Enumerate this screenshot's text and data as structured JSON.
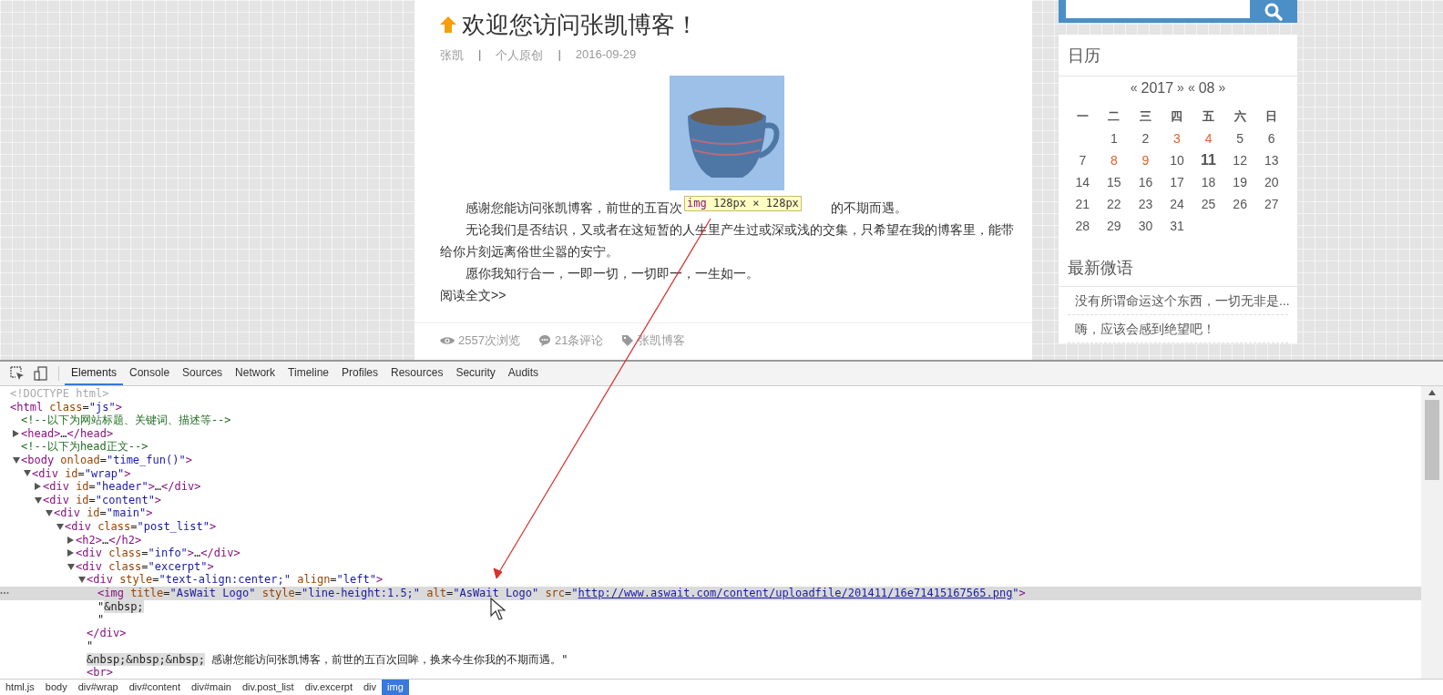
{
  "post": {
    "title": "欢迎您访问张凯博客！",
    "meta": [
      {
        "kind": "text",
        "text": "张凯"
      },
      {
        "kind": "separator",
        "text": "|"
      },
      {
        "kind": "text",
        "text": "个人原创"
      },
      {
        "kind": "separator",
        "text": "|"
      },
      {
        "kind": "text",
        "text": "2016-09-29"
      }
    ],
    "paragraphs": [
      {
        "text_left": "感谢您能访问张凯博客，前世的五百次",
        "tooltip": {
          "tag": "img",
          "size": "128px × 128px"
        },
        "text_right": "的不期而遇。"
      },
      {
        "text": "无论我们是否结识，又或者在这短暂的人生里产生过或深或浅的交集，只希望在我的博客里，能带给你片刻远离俗世尘嚣的安宁。"
      },
      {
        "text": "愿你我知行合一，一即一切，一切即一，一生如一。"
      }
    ],
    "read_more": "阅读全文>>",
    "stats": [
      {
        "kind": "views",
        "text": "2557次浏览"
      },
      {
        "kind": "comments",
        "text": "21条评论"
      },
      {
        "kind": "tag",
        "text": "张凯博客"
      }
    ]
  },
  "sidebar": {
    "calendar": {
      "title": "日历",
      "nav": [
        {
          "kind": "prev",
          "text": "«"
        },
        {
          "kind": "label",
          "text": "2017"
        },
        {
          "kind": "next",
          "text": "»"
        },
        {
          "kind": "prev",
          "text": "«"
        },
        {
          "kind": "label",
          "text": "08"
        },
        {
          "kind": "next",
          "text": "»"
        }
      ],
      "weekdays": [
        "一",
        "二",
        "三",
        "四",
        "五",
        "六",
        "日"
      ],
      "days": [
        {
          "kind": "blank"
        },
        {
          "kind": "day",
          "text": "1"
        },
        {
          "kind": "day",
          "text": "2"
        },
        {
          "kind": "marked",
          "text": "3"
        },
        {
          "kind": "marked",
          "text": "4"
        },
        {
          "kind": "day",
          "text": "5"
        },
        {
          "kind": "day",
          "text": "6"
        },
        {
          "kind": "day",
          "text": "7"
        },
        {
          "kind": "marked",
          "text": "8"
        },
        {
          "kind": "marked",
          "text": "9"
        },
        {
          "kind": "day",
          "text": "10"
        },
        {
          "kind": "today",
          "text": "11"
        },
        {
          "kind": "day",
          "text": "12"
        },
        {
          "kind": "day",
          "text": "13"
        },
        {
          "kind": "day",
          "text": "14"
        },
        {
          "kind": "day",
          "text": "15"
        },
        {
          "kind": "day",
          "text": "16"
        },
        {
          "kind": "day",
          "text": "17"
        },
        {
          "kind": "day",
          "text": "18"
        },
        {
          "kind": "day",
          "text": "19"
        },
        {
          "kind": "day",
          "text": "20"
        },
        {
          "kind": "day",
          "text": "21"
        },
        {
          "kind": "day",
          "text": "22"
        },
        {
          "kind": "day",
          "text": "23"
        },
        {
          "kind": "day",
          "text": "24"
        },
        {
          "kind": "day",
          "text": "25"
        },
        {
          "kind": "day",
          "text": "26"
        },
        {
          "kind": "day",
          "text": "27"
        },
        {
          "kind": "day",
          "text": "28"
        },
        {
          "kind": "day",
          "text": "29"
        },
        {
          "kind": "day",
          "text": "30"
        },
        {
          "kind": "day",
          "text": "31"
        }
      ]
    },
    "weibo": {
      "title": "最新微语",
      "items": [
        "没有所谓命运这个东西，一切无非是...",
        "嗨，应该会感到绝望吧！"
      ]
    }
  },
  "devtools": {
    "tabs": [
      {
        "label": "Elements",
        "selected": true
      },
      {
        "label": "Console",
        "selected": false
      },
      {
        "label": "Sources",
        "selected": false
      },
      {
        "label": "Network",
        "selected": false
      },
      {
        "label": "Timeline",
        "selected": false
      },
      {
        "label": "Profiles",
        "selected": false
      },
      {
        "label": "Resources",
        "selected": false
      },
      {
        "label": "Security",
        "selected": false
      },
      {
        "label": "Audits",
        "selected": false
      }
    ],
    "tree": [
      {
        "kind": "doctype",
        "text": "<!DOCTYPE html>",
        "selected": false
      },
      {
        "kind": "element",
        "text": "<html class=\"js\">",
        "selected": false,
        "children": [
          {
            "kind": "comment",
            "text": "<!--以下为网站标题、关键词、描述等-->",
            "selected": false
          },
          {
            "kind": "element",
            "text": "<head>…</head>",
            "selected": false,
            "expanded": false
          },
          {
            "kind": "comment",
            "text": "<!--以下为head正文-->",
            "selected": false
          },
          {
            "kind": "element",
            "text": "<body onload=\"time_fun()\">",
            "selected": false,
            "expanded": true,
            "children": [
              {
                "kind": "element",
                "text": "<div id=\"wrap\">",
                "selected": false,
                "expanded": true,
                "children": [
                  {
                    "kind": "element",
                    "text": "<div id=\"header\">…</div>",
                    "selected": false,
                    "expanded": false
                  },
                  {
                    "kind": "element",
                    "text": "<div id=\"content\">",
                    "selected": false,
                    "expanded": true,
                    "children": [
                      {
                        "kind": "element",
                        "text": "<div id=\"main\">",
                        "selected": false,
                        "expanded": true,
                        "children": [
                          {
                            "kind": "element",
                            "text": "<div class=\"post_list\">",
                            "selected": false,
                            "expanded": true,
                            "children": [
                              {
                                "kind": "element",
                                "text": "<h2>…</h2>",
                                "selected": false,
                                "expanded": false
                              },
                              {
                                "kind": "element",
                                "text": "<div class=\"info\">…</div>",
                                "selected": false,
                                "expanded": false
                              },
                              {
                                "kind": "element",
                                "text": "<div class=\"excerpt\">",
                                "selected": false,
                                "expanded": true,
                                "children": [
                                  {
                                    "kind": "element",
                                    "text": "<div style=\"text-align:center;\" align=\"left\">",
                                    "selected": false,
                                    "expanded": true,
                                    "close": "</div>",
                                    "children": [
                                      {
                                        "kind": "element",
                                        "text": "<img title=\"AsWait Logo\" style=\"line-height:1.5;\" alt=\"AsWait Logo\" src=\"http://www.aswait.com/content/uploadfile/201411/16e71415167565.png\">",
                                        "selected": true,
                                        "link": true
                                      },
                                      {
                                        "kind": "text",
                                        "lines": [
                                          "\"&nbsp;",
                                          "\""
                                        ],
                                        "selected": false
                                      }
                                    ]
                                  },
                                  {
                                    "kind": "text",
                                    "lines": [
                                      "\"",
                                      "&nbsp;&nbsp;&nbsp; 感谢您能访问张凯博客，前世的五百次回眸，换来今生你我的不期而遇。\""
                                    ],
                                    "selected": false
                                  },
                                  {
                                    "kind": "element",
                                    "text": "<br>",
                                    "selected": false
                                  }
                                ]
                              }
                            ]
                          }
                        ]
                      }
                    ]
                  }
                ]
              }
            ]
          }
        ]
      }
    ],
    "breadcrumb": [
      {
        "label": "html.js",
        "selected": false
      },
      {
        "label": "body",
        "selected": false
      },
      {
        "label": "div#wrap",
        "selected": false
      },
      {
        "label": "div#content",
        "selected": false
      },
      {
        "label": "div#main",
        "selected": false
      },
      {
        "label": "div.post_list",
        "selected": false
      },
      {
        "label": "div.excerpt",
        "selected": false
      },
      {
        "label": "div",
        "selected": false
      },
      {
        "label": "img",
        "selected": true
      }
    ]
  }
}
